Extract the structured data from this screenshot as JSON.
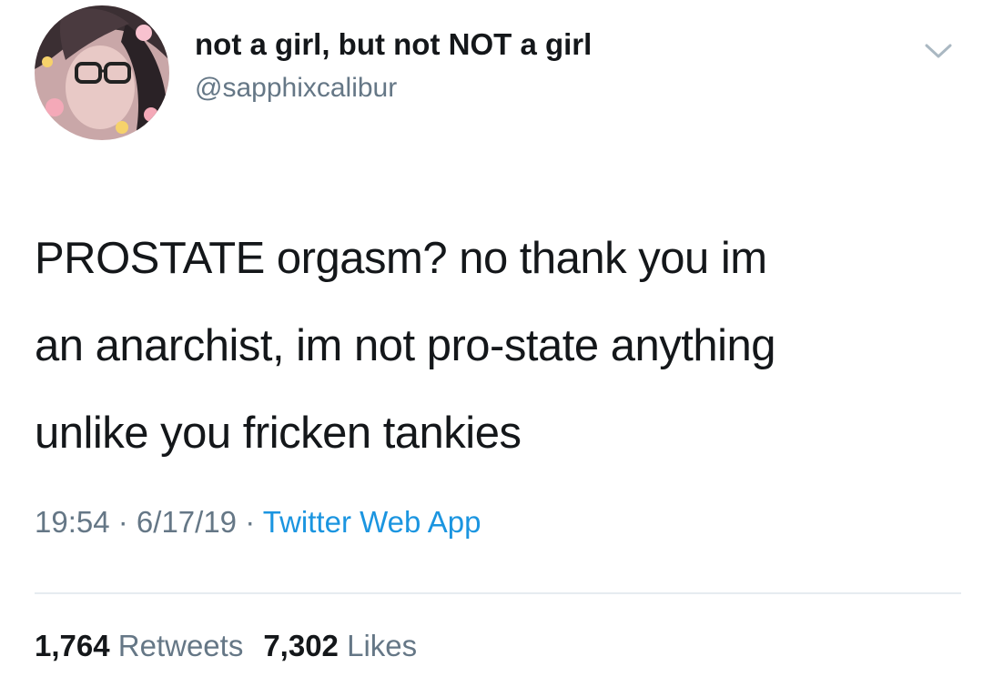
{
  "tweet": {
    "display_name": "not a girl, but not NOT a girl",
    "handle": "@sapphixcalibur",
    "text_lines": [
      "PROSTATE orgasm? no thank you im",
      "an anarchist, im not pro-state anything",
      "unlike you fricken tankies"
    ],
    "time": "19:54",
    "date": "6/17/19",
    "source": "Twitter Web App",
    "separator": " · ",
    "retweets": {
      "count": "1,764",
      "label": "Retweets"
    },
    "likes": {
      "count": "7,302",
      "label": "Likes"
    }
  },
  "icons": {
    "avatar": "profile-picture",
    "menu": "chevron-down-icon"
  },
  "colors": {
    "name": "#14171a",
    "secondary": "#657786",
    "link": "#1b95e0",
    "divider": "#e6ecf0"
  }
}
